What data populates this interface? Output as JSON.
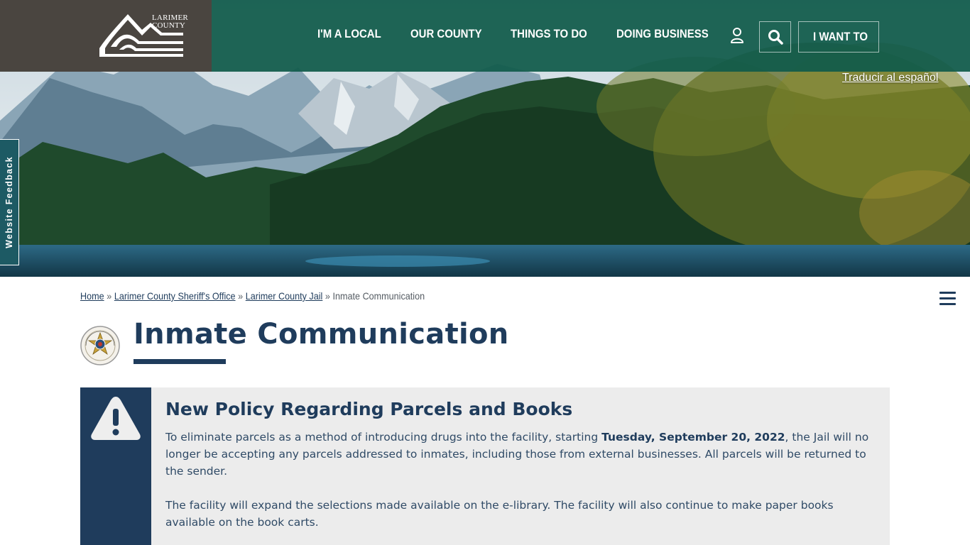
{
  "header": {
    "logo_line1": "LARIMER",
    "logo_line2": "COUNTY",
    "nav": [
      "I'M A LOCAL",
      "OUR COUNTY",
      "THINGS TO DO",
      "DOING BUSINESS"
    ],
    "account_icon": "user-icon",
    "search_icon": "search-icon",
    "i_want_to": "I WANT TO"
  },
  "translate_link": "Traducir al español",
  "feedback_tab": "Website Feedback",
  "breadcrumb": {
    "items": [
      "Home",
      "Larimer County Sheriff's Office",
      "Larimer County Jail"
    ],
    "separator": "»",
    "current": "Inmate Communication"
  },
  "page": {
    "title": "Inmate Communication",
    "badge_icon": "sheriff-badge-icon",
    "menu_icon": "hamburger-menu-icon"
  },
  "alert": {
    "icon": "warning-icon",
    "title": "New Policy Regarding Parcels and Books",
    "p1_before": "To eliminate parcels as a method of introducing drugs into the facility, starting ",
    "p1_bold": "Tuesday, September 20, 2022",
    "p1_after": ", the Jail will no longer be accepting any parcels addressed to inmates, including those from external businesses. All parcels will be returned to the sender.",
    "p2": "The facility will expand the selections made available on the e-library. The facility will also continue to make paper books available on the book carts."
  },
  "colors": {
    "header_green": "#105a4a",
    "logo_bg": "#4a4540",
    "navy": "#1f3c5c",
    "alert_bg": "#ececec",
    "feedback_bg": "#1d5a64"
  }
}
